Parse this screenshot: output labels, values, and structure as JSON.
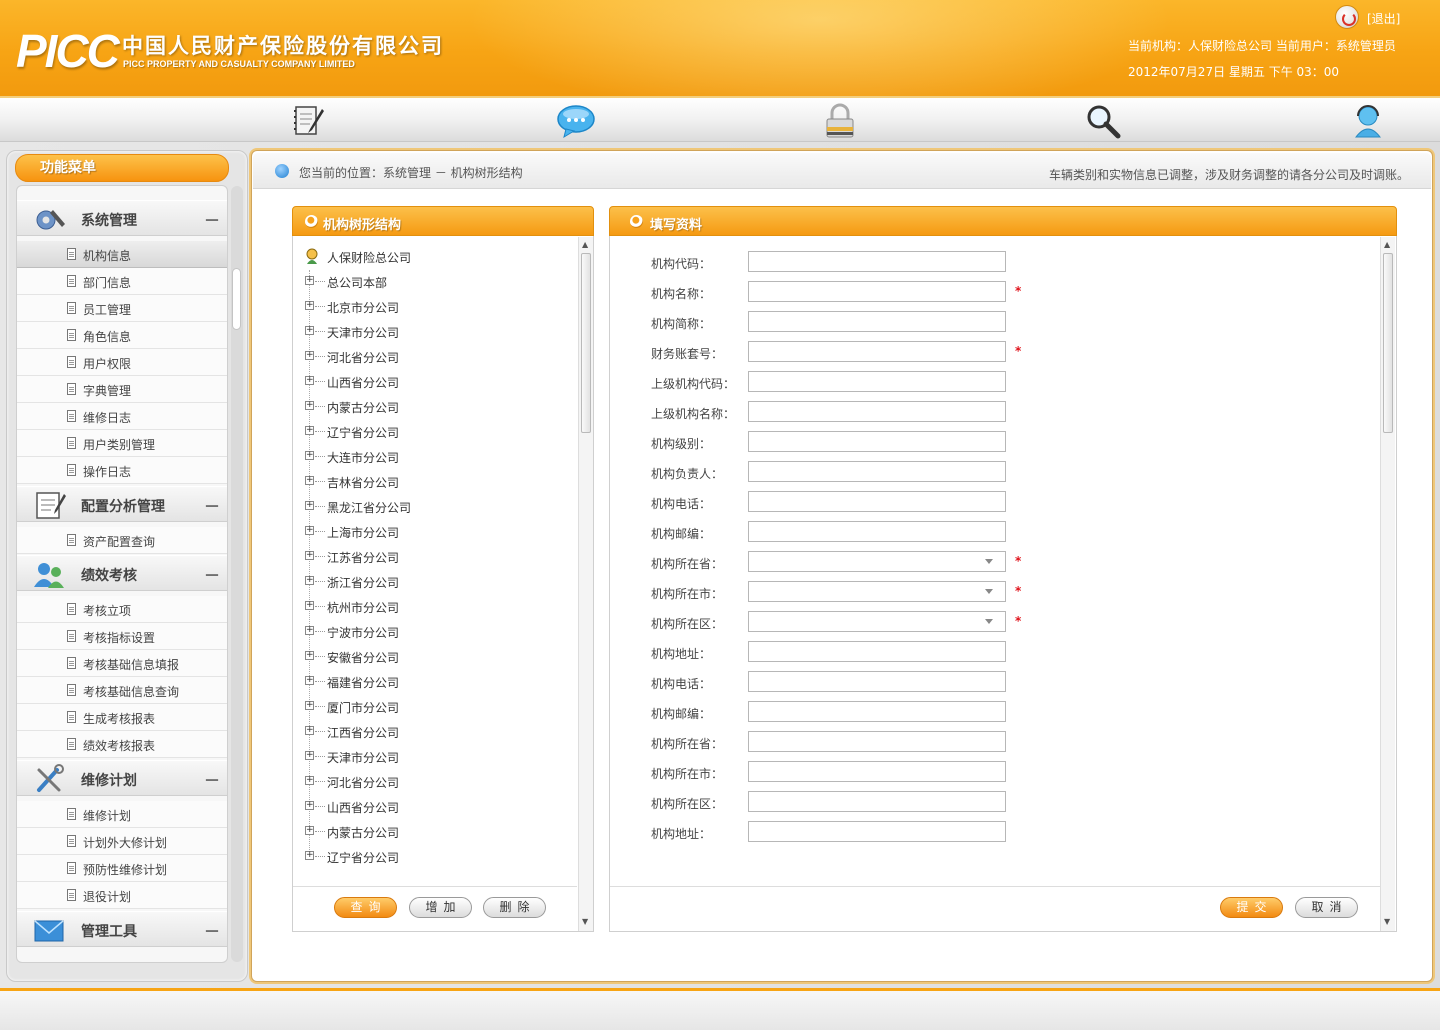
{
  "header": {
    "logo_text": "PICC",
    "company_cn": "中国人民财产保险股份有限公司",
    "company_en": "PICC PROPERTY AND CASUALTY COMPANY LIMITED",
    "logout": "[退出]",
    "user_info": "当前机构：人保财险总公司    当前用户：系统管理员",
    "datetime": "2012年07月27日  星期五  下午  03：00",
    "brand_color": "#f7a414"
  },
  "toolbar": {
    "icons": [
      "notebook-icon",
      "chat-bubble-icon",
      "lock-icon",
      "search-icon",
      "user-support-icon"
    ]
  },
  "sidebar": {
    "title": "功能菜单",
    "groups": [
      {
        "label": "系统管理",
        "toggle": "－",
        "icon": "gear-wrench-icon",
        "items": [
          "机构信息",
          "部门信息",
          "员工管理",
          "角色信息",
          "用户权限",
          "字典管理",
          "维修日志",
          "用户类别管理",
          "操作日志"
        ]
      },
      {
        "label": "配置分析管理",
        "toggle": "－",
        "icon": "clipboard-icon",
        "items": [
          "资产配置查询"
        ]
      },
      {
        "label": "绩效考核",
        "toggle": "－",
        "icon": "users-icon",
        "items": [
          "考核立项",
          "考核指标设置",
          "考核基础信息填报",
          "考核基础信息查询",
          "生成考核报表",
          "绩效考核报表"
        ]
      },
      {
        "label": "维修计划",
        "toggle": "－",
        "icon": "tools-icon",
        "items": [
          "维修计划",
          "计划外大修计划",
          "预防性维修计划",
          "退役计划"
        ]
      },
      {
        "label": "管理工具",
        "toggle": "－",
        "icon": "envelope-icon",
        "items": []
      }
    ]
  },
  "breadcrumb": {
    "text": "您当前的位置：系统管理 － 机构树形结构",
    "notice": "车辆类别和实物信息已调整，涉及财务调整的请各分公司及时调账。"
  },
  "tree_panel": {
    "title": "机构树形结构",
    "root": "人保财险总公司",
    "nodes": [
      "总公司本部",
      "北京市分公司",
      "天津市分公司",
      "河北省分公司",
      "山西省分公司",
      "内蒙古分公司",
      "辽宁省分公司",
      "大连市分公司",
      "吉林省分公司",
      "黑龙江省分公司",
      "上海市分公司",
      "江苏省分公司",
      "浙江省分公司",
      "杭州市分公司",
      "宁波市分公司",
      "安徽省分公司",
      "福建省分公司",
      "厦门市分公司",
      "江西省分公司",
      "天津市分公司",
      "河北省分公司",
      "山西省分公司",
      "内蒙古分公司",
      "辽宁省分公司"
    ],
    "buttons": {
      "query": "查询",
      "add": "增加",
      "delete": "删除"
    }
  },
  "form_panel": {
    "title": "填写资料",
    "fields": [
      {
        "label": "机构代码：",
        "required": false,
        "type": "text",
        "value": ""
      },
      {
        "label": "机构名称：",
        "required": true,
        "type": "text",
        "value": ""
      },
      {
        "label": "机构简称：",
        "required": false,
        "type": "text",
        "value": ""
      },
      {
        "label": "财务账套号：",
        "required": true,
        "type": "text",
        "value": ""
      },
      {
        "label": "上级机构代码：",
        "required": false,
        "type": "text",
        "value": ""
      },
      {
        "label": "上级机构名称：",
        "required": false,
        "type": "text",
        "value": ""
      },
      {
        "label": "机构级别：",
        "required": false,
        "type": "text",
        "value": ""
      },
      {
        "label": "机构负责人：",
        "required": false,
        "type": "text",
        "value": ""
      },
      {
        "label": "机构电话：",
        "required": false,
        "type": "text",
        "value": ""
      },
      {
        "label": "机构邮编：",
        "required": false,
        "type": "text",
        "value": ""
      },
      {
        "label": "机构所在省：",
        "required": true,
        "type": "select",
        "value": ""
      },
      {
        "label": "机构所在市：",
        "required": true,
        "type": "select",
        "value": ""
      },
      {
        "label": "机构所在区：",
        "required": true,
        "type": "select",
        "value": ""
      },
      {
        "label": "机构地址：",
        "required": false,
        "type": "text",
        "value": ""
      },
      {
        "label": "机构电话：",
        "required": false,
        "type": "text",
        "value": ""
      },
      {
        "label": "机构邮编：",
        "required": false,
        "type": "text",
        "value": ""
      },
      {
        "label": "机构所在省：",
        "required": false,
        "type": "text",
        "value": ""
      },
      {
        "label": "机构所在市：",
        "required": false,
        "type": "text",
        "value": ""
      },
      {
        "label": "机构所在区：",
        "required": false,
        "type": "text",
        "value": ""
      },
      {
        "label": "机构地址：",
        "required": false,
        "type": "text",
        "value": ""
      }
    ],
    "required_mark": "*",
    "buttons": {
      "submit": "提交",
      "cancel": "取消"
    }
  }
}
